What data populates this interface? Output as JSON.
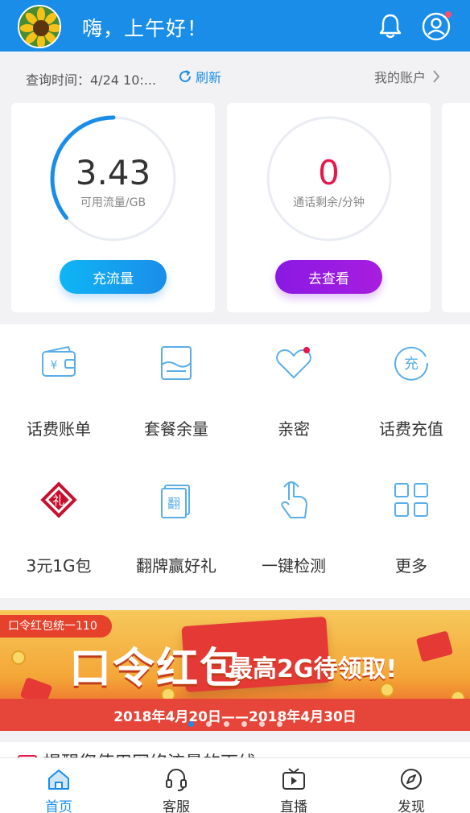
{
  "header": {
    "greeting": "嗨，上午好！",
    "bg_color": "#1a8de9"
  },
  "query": {
    "time_text": "查询时间：4/24 10:...",
    "refresh_label": "刷新",
    "account_label": "我的账户"
  },
  "cards": [
    {
      "value": "3.43",
      "label": "可用流量/GB",
      "button": "充流量",
      "fill_fraction": 0.36,
      "accent": "#1a8de9"
    },
    {
      "value": "0",
      "label": "通话剩余/分钟",
      "button": "去查看",
      "fill_fraction": 0,
      "accent": "#e8174b"
    }
  ],
  "grid": [
    {
      "label": "话费账单",
      "icon": "wallet-yuan-icon"
    },
    {
      "label": "套餐余量",
      "icon": "balance-box-icon"
    },
    {
      "label": "亲密",
      "icon": "heart-icon"
    },
    {
      "label": "话费充值",
      "icon": "recharge-icon"
    },
    {
      "label": "3元1G包",
      "icon": "gift-package-icon",
      "icon_text": "礼"
    },
    {
      "label": "翻牌赢好礼",
      "icon": "flip-card-icon",
      "icon_text": "翻"
    },
    {
      "label": "一键检测",
      "icon": "touch-hand-icon"
    },
    {
      "label": "更多",
      "icon": "more-grid-icon"
    }
  ],
  "banner": {
    "tag": "口令红包统一110",
    "headline": "口令红包",
    "subline": "最高2G待领取!",
    "dates": "2018年4月20日——2018年4月30日",
    "slide_count": 6,
    "active_slide": 0
  },
  "peek": {
    "text": "提醒您使用网络流量的下线"
  },
  "tabbar": [
    {
      "label": "首页",
      "icon": "home-icon",
      "active": true
    },
    {
      "label": "客服",
      "icon": "headset-icon",
      "active": false
    },
    {
      "label": "直播",
      "icon": "tv-play-icon",
      "active": false
    },
    {
      "label": "发现",
      "icon": "compass-icon",
      "active": false
    }
  ]
}
